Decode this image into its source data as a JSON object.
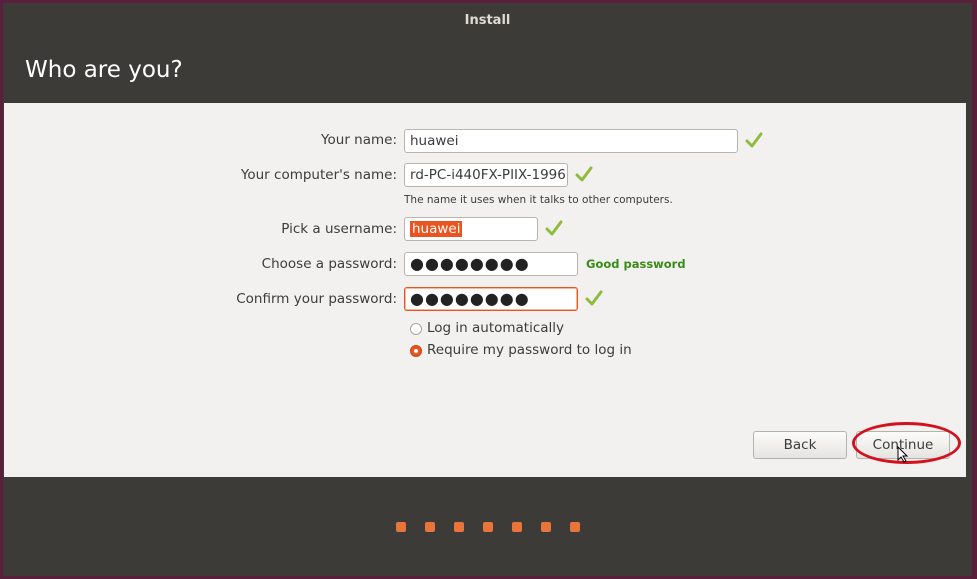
{
  "window": {
    "title": "Install"
  },
  "page": {
    "title": "Who are you?"
  },
  "form": {
    "name": {
      "label": "Your name:",
      "value": "huawei"
    },
    "computer": {
      "label": "Your computer's name:",
      "value": "rd-PC-i440FX-PIIX-1996",
      "hint": "The name it uses when it talks to other computers."
    },
    "username": {
      "label": "Pick a username:",
      "value": "huawei"
    },
    "password": {
      "label": "Choose a password:",
      "value": "●●●●●●●●",
      "strength": "Good password"
    },
    "confirm": {
      "label": "Confirm your password:",
      "value": "●●●●●●●●"
    },
    "login_options": [
      {
        "label": "Log in automatically",
        "selected": false
      },
      {
        "label": "Require my password to log in",
        "selected": true
      }
    ]
  },
  "buttons": {
    "back": "Back",
    "continue": "Continue"
  },
  "progress": {
    "steps": 7
  },
  "colors": {
    "accent": "#e95420",
    "check": "#8fbc3c",
    "good": "#3a8a18",
    "annotation": "#d4111e"
  }
}
